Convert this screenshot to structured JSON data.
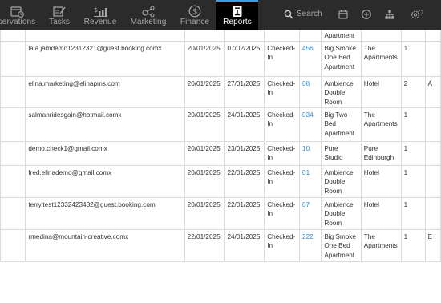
{
  "nav": {
    "items": [
      {
        "label": "servations",
        "icon": "calendar-icon"
      },
      {
        "label": "Tasks",
        "icon": "clipboard-pen-icon"
      },
      {
        "label": "Revenue",
        "icon": "bar-chart-dollar-icon"
      },
      {
        "label": "Marketing",
        "icon": "network-share-icon"
      },
      {
        "label": "Finance",
        "icon": "dollar-circle-icon"
      },
      {
        "label": "Reports",
        "icon": "report-icon"
      }
    ],
    "search_label": "Search",
    "right_icons": [
      "calendar-icon",
      "plus-circle-icon",
      "org-chart-icon",
      "settings-icon"
    ]
  },
  "table": {
    "top_partial_row": {
      "type_line": "Apartment"
    },
    "rows": [
      {
        "email": "lala.jamdemo12312321@guest.booking.comx",
        "arrival": "20/01/2025",
        "departure": "07/02/2025",
        "status": "Checked-In",
        "room": "456",
        "room_type": "Big Smoke One Bed Apartment",
        "property": "The Apartments",
        "guests": "1",
        "extra": ""
      },
      {
        "email": "elina.marketing@elinapms.com",
        "arrival": "20/01/2025",
        "departure": "27/01/2025",
        "status": "Checked-In",
        "room": "08",
        "room_type": "Ambience Double Room",
        "property": "Hotel",
        "guests": "2",
        "extra": "A"
      },
      {
        "email": "salmanridesgain@hotmail.comx",
        "arrival": "20/01/2025",
        "departure": "24/01/2025",
        "status": "Checked-In",
        "room": "034",
        "room_type": "Big Two Bed Apartment",
        "property": "The Apartments",
        "guests": "1",
        "extra": ""
      },
      {
        "email": "demo.check1@gmail.comx",
        "arrival": "20/01/2025",
        "departure": "23/01/2025",
        "status": "Checked-In",
        "room": "10",
        "room_type": "Pure Studio",
        "property": "Pure Edinburgh",
        "guests": "1",
        "extra": ""
      },
      {
        "email": "fred.elinademo@gmail.comx",
        "arrival": "20/01/2025",
        "departure": "22/01/2025",
        "status": "Checked-In",
        "room": "01",
        "room_type": "Ambience Double Room",
        "property": "Hotel",
        "guests": "1",
        "extra": ""
      },
      {
        "email": "terry.test12332423432@guest.booking.com",
        "arrival": "20/01/2025",
        "departure": "22/01/2025",
        "status": "Checked-In",
        "room": "07",
        "room_type": "Ambience Double Room",
        "property": "Hotel",
        "guests": "1",
        "extra": ""
      },
      {
        "email": "rmedina@mountain-creative.comx",
        "arrival": "22/01/2025",
        "departure": "24/01/2025",
        "status": "Checked-In",
        "room": "222",
        "room_type": "Big Smoke One Bed Apartment",
        "property": "The Apartments",
        "guests": "1",
        "extra": "E i"
      }
    ]
  }
}
